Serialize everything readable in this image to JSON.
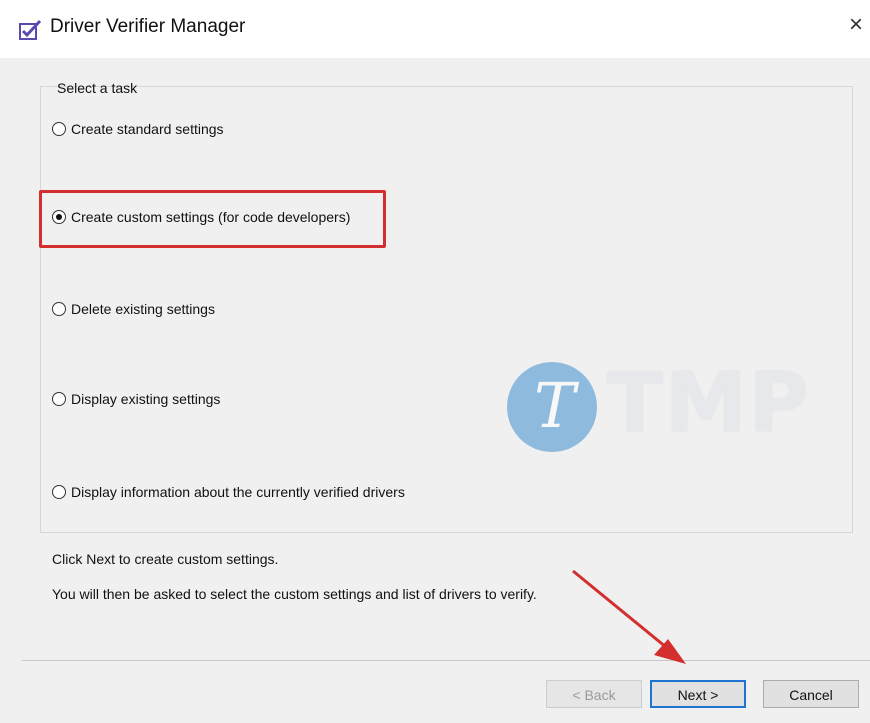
{
  "window": {
    "title": "Driver Verifier Manager",
    "close_glyph": "×"
  },
  "task_group": {
    "label": "Select a task",
    "options": [
      {
        "label": "Create standard settings",
        "checked": false
      },
      {
        "label": "Create custom settings (for code developers)",
        "checked": true
      },
      {
        "label": "Delete existing settings",
        "checked": false
      },
      {
        "label": "Display existing settings",
        "checked": false
      },
      {
        "label": "Display information about the currently verified drivers",
        "checked": false
      }
    ]
  },
  "info": {
    "line1": "Click Next to create custom settings.",
    "line2": "You will then be asked to select the custom settings and list of drivers to verify."
  },
  "buttons": {
    "back": "< Back",
    "next": "Next >",
    "cancel": "Cancel"
  },
  "watermark": {
    "text": "TMP",
    "letter": "T"
  },
  "colors": {
    "highlight": "#d32f2f",
    "arrow": "#d32f2f",
    "default_button_border": "#1e74d0",
    "watermark_circle": "#3f8fd0"
  }
}
